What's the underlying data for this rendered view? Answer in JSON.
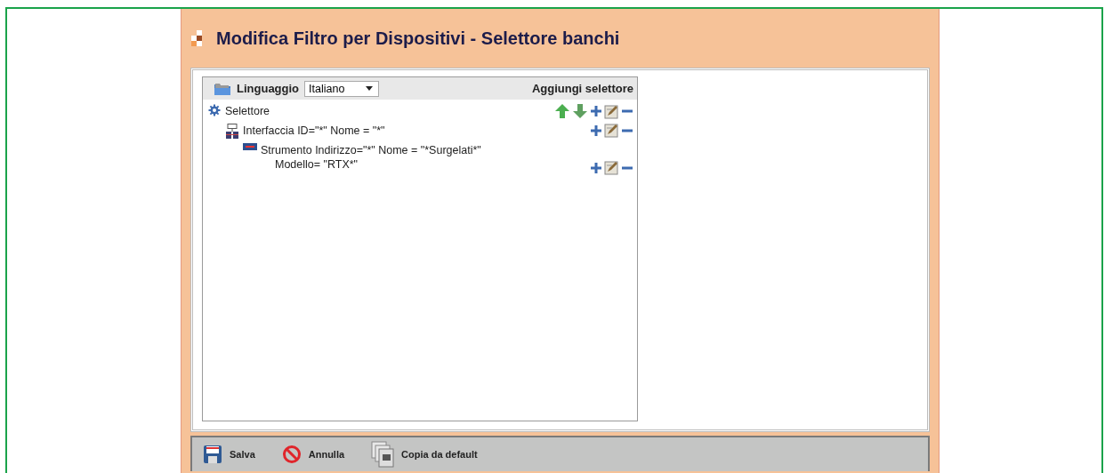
{
  "window": {
    "title": "Modifica Filtro per Dispositivi - Selettore banchi"
  },
  "tree_header": {
    "language_label": "Linguaggio",
    "language_value": "Italiano",
    "add_selector": "Aggiungi selettore"
  },
  "tree": [
    {
      "kind": "selector",
      "lines": [
        "Selettore"
      ],
      "movable": true,
      "children": [
        {
          "kind": "interface",
          "lines": [
            "Interfaccia ID=\"*\" Nome = \"*\""
          ],
          "movable": false,
          "children": [
            {
              "kind": "instrument",
              "lines": [
                "Strumento Indirizzo=\"*\" Nome = \"*Surgelati*\"",
                "Modello= \"RTX*\""
              ],
              "movable": false
            }
          ]
        }
      ]
    }
  ],
  "toolbar": [
    {
      "kind": "save",
      "label": "Salva"
    },
    {
      "kind": "cancel",
      "label": "Annulla"
    },
    {
      "kind": "copy",
      "label": "Copia da default"
    }
  ]
}
